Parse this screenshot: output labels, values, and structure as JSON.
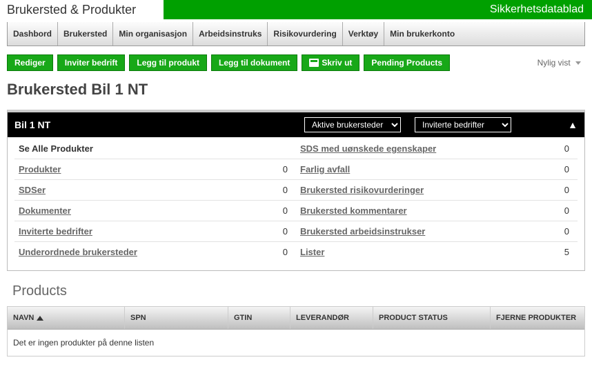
{
  "header": {
    "left_title": "Brukersted & Produkter",
    "right_title": "Sikkerhetsdatablad"
  },
  "tabs": [
    "Dashbord",
    "Brukersted",
    "Min organisasjon",
    "Arbeidsinstruks",
    "Risikovurdering",
    "Verktøy",
    "Min brukerkonto"
  ],
  "actions": {
    "edit": "Rediger",
    "invite": "Inviter bedrift",
    "add_product": "Legg til produkt",
    "add_document": "Legg til dokument",
    "print": "Skriv ut",
    "pending": "Pending Products"
  },
  "recent_label": "Nylig vist",
  "page_title": "Brukersted Bil 1 NT",
  "location": {
    "name": "Bil 1 NT",
    "select1": "Aktive brukersteder",
    "select2": "Inviterte bedrifter",
    "left": [
      {
        "label": "Se Alle Produkter",
        "count": "",
        "bold_nou": true
      },
      {
        "label": "Produkter",
        "count": "0"
      },
      {
        "label": "SDSer",
        "count": "0"
      },
      {
        "label": "Dokumenter",
        "count": "0"
      },
      {
        "label": "Inviterte bedrifter",
        "count": "0"
      },
      {
        "label": "Underordnede brukersteder",
        "count": "0"
      }
    ],
    "right": [
      {
        "label": "SDS med uønskede egenskaper",
        "count": "0"
      },
      {
        "label": "Farlig avfall",
        "count": "0"
      },
      {
        "label": "Brukersted risikovurderinger",
        "count": "0"
      },
      {
        "label": "Brukersted kommentarer",
        "count": "0"
      },
      {
        "label": "Brukersted arbeidsinstrukser",
        "count": "0"
      },
      {
        "label": "Lister",
        "count": "5"
      }
    ]
  },
  "products": {
    "title": "Products",
    "columns": {
      "navn": "NAVN",
      "spn": "SPN",
      "gtin": "GTIN",
      "lev": "LEVERANDØR",
      "status": "PRODUCT STATUS",
      "fjerne": "FJERNE PRODUKTER"
    },
    "empty": "Det er ingen produkter på denne listen"
  }
}
